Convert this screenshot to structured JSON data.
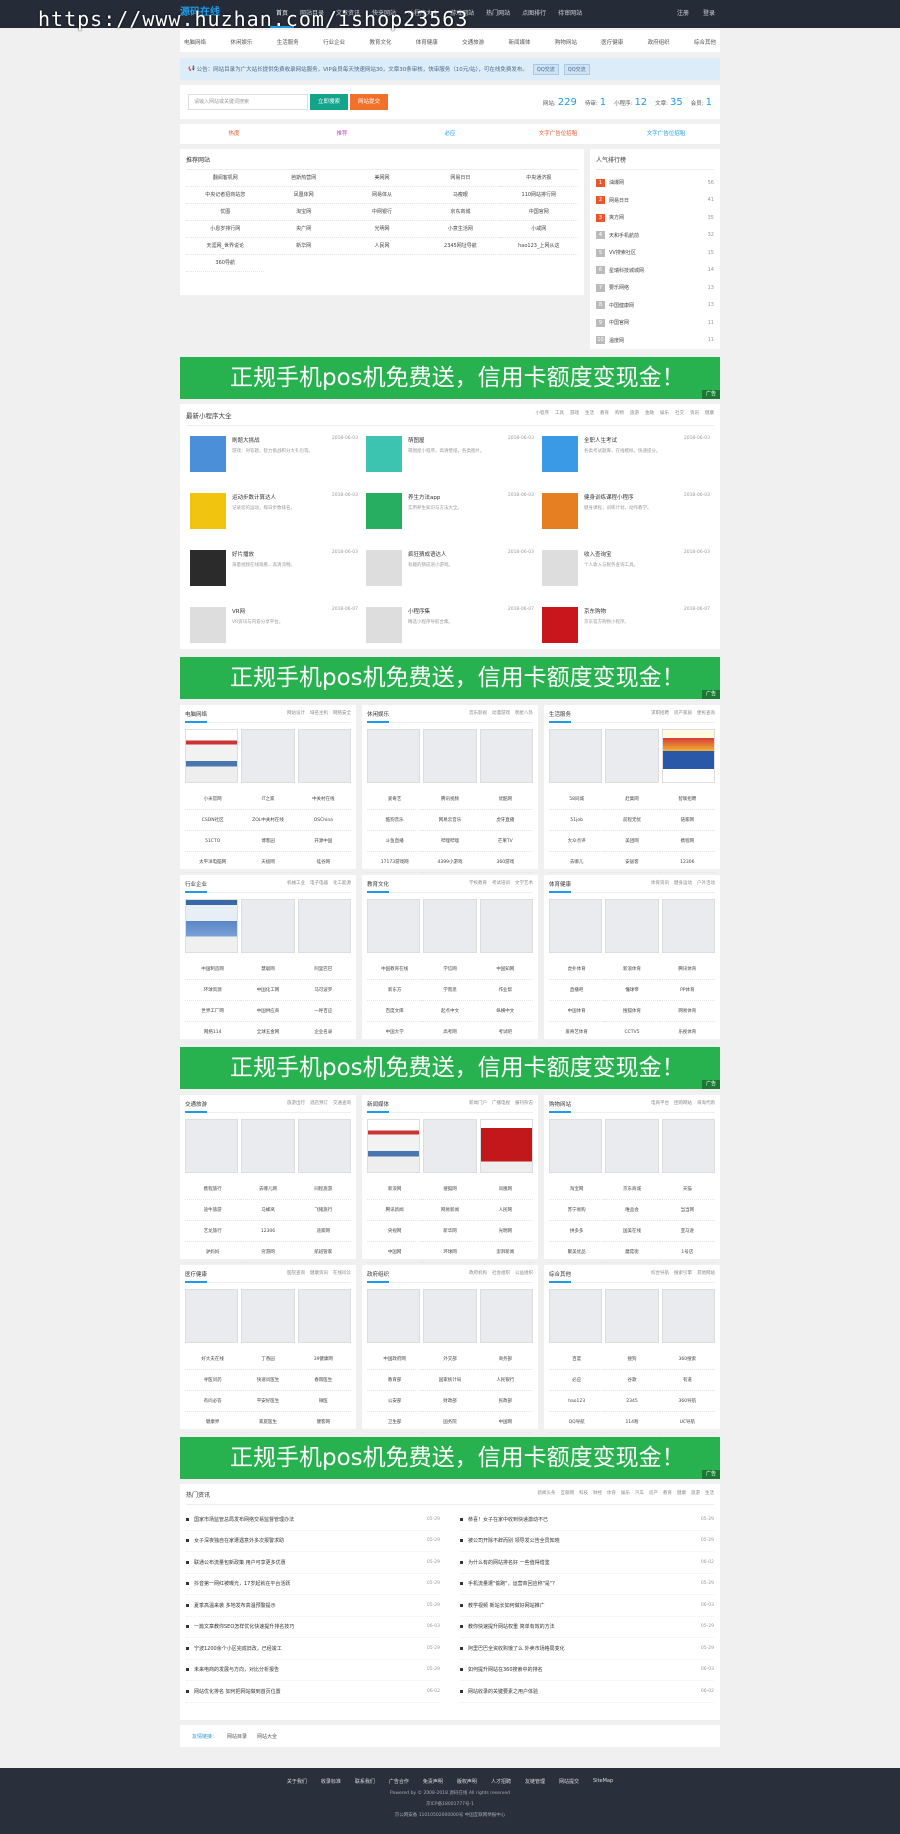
{
  "watermark": "https://www.huzhan.com/ishop23563",
  "logo": "源码在线",
  "topnav": [
    "首页",
    "网站目录",
    "文章资讯",
    "快来网站",
    "小程序大全",
    "游戏网站",
    "热门网站",
    "点图排行",
    "待审网站"
  ],
  "toplogin": [
    "注册",
    "登录"
  ],
  "catnav": [
    "电脑网络",
    "休闲娱乐",
    "生活服务",
    "行业企业",
    "教育文化",
    "体育健康",
    "交通旅游",
    "新闻媒体",
    "购物网站",
    "医疗健康",
    "政府组织",
    "综合其他"
  ],
  "notice": {
    "text": "公告：网站目录为广大站长提供免费收录网站服务，VIP会员每天快速网站30，文章30条审核，快审服务（10元/站），可在线免费发布。",
    "qq1": "QQ交流",
    "qq2": "QQ交流"
  },
  "search": {
    "placeholder": "请输入网站或关键词搜索",
    "btn1": "立即搜索",
    "btn2": "网站提交",
    "stats": [
      {
        "label": "网站:",
        "value": "229"
      },
      {
        "label": "待审:",
        "value": "1"
      },
      {
        "label": "小程序:",
        "value": "12"
      },
      {
        "label": "文章:",
        "value": "35"
      },
      {
        "label": "会员:",
        "value": "1"
      }
    ]
  },
  "tabs": [
    "热度",
    "推荐",
    "必应",
    "文字广告位招租",
    "文字广告位招租"
  ],
  "sites": {
    "title": "推荐网站",
    "items": [
      "翻阅客机网",
      "芭斯热营网",
      "美网网",
      "网易日日",
      "中央通济报",
      "中央记者招商站您",
      "凤凰体网",
      "网易体从",
      "马瘦眼",
      "110网站排行网",
      "优图",
      "淘宝网",
      "中网银行",
      "京东商城",
      "中国官网",
      "小恩岁排行网",
      "央广网",
      "光明网",
      "小意生活网",
      "小咸网",
      "天涯网_世界说论",
      "新华网",
      "人民网",
      "2345网址导航",
      "hao123_上网从这",
      "360导航"
    ]
  },
  "rank": {
    "title": "人气排行榜",
    "items": [
      {
        "n": "1",
        "name": "油爆网",
        "v": "56"
      },
      {
        "n": "2",
        "name": "网易日日",
        "v": "41"
      },
      {
        "n": "3",
        "name": "爽方网",
        "v": "35"
      },
      {
        "n": "4",
        "name": "天和手机航前",
        "v": "32"
      },
      {
        "n": "5",
        "name": "VV搜索社区",
        "v": "15"
      },
      {
        "n": "6",
        "name": "星瑞科技城城网",
        "v": "14"
      },
      {
        "n": "7",
        "name": "要乐网络",
        "v": "13"
      },
      {
        "n": "8",
        "name": "中国健康网",
        "v": "13"
      },
      {
        "n": "9",
        "name": "中国官网",
        "v": "11"
      },
      {
        "n": "10",
        "name": "温度网",
        "v": "11"
      }
    ]
  },
  "banner": {
    "text": "正规手机pos机免费送，信用卡额度变现金！",
    "ad": "广告"
  },
  "mini": {
    "title": "最新小程序大全",
    "cats": [
      "小程序",
      "工具",
      "游戏",
      "生活",
      "教育",
      "购物",
      "旅游",
      "金融",
      "娱乐",
      "社交",
      "资讯",
      "健康"
    ],
    "apps": [
      {
        "name": "刷题大挑战",
        "date": "2018-06-03",
        "desc": "游戏：对答题，智力挑战积分大礼包等。",
        "color": "#4a8fd8"
      },
      {
        "name": "萌图屋",
        "date": "2018-06-03",
        "desc": "萌图屋小程序，高清壁纸，各类图片。",
        "color": "#3cc4b0"
      },
      {
        "name": "全职人生考试",
        "date": "2018-06-03",
        "desc": "各类考试题库，在线模拟，快速提分。",
        "color": "#3a9ae6"
      },
      {
        "name": "运动步数计算达人",
        "date": "2018-06-03",
        "desc": "记录您的运动，每日步数排名。",
        "color": "#f1c40f"
      },
      {
        "name": "养生方法app",
        "date": "2018-06-03",
        "desc": "实用养生知识与方法大全。",
        "color": "#27ae60"
      },
      {
        "name": "健身训练课程小程序",
        "date": "2018-06-03",
        "desc": "健身课程，训练计划，动作教学。",
        "color": "#e67e22"
      },
      {
        "name": "好片播放",
        "date": "2018-06-03",
        "desc": "海量视频在线观看，高清流畅。",
        "color": "#2b2b2b"
      },
      {
        "name": "疯狂猜成语达人",
        "date": "2018-06-03",
        "desc": "有趣的猜成语小游戏。",
        "color": "#ddd"
      },
      {
        "name": "收入查询宝",
        "date": "2018-06-03",
        "desc": "个人收入与税务查询工具。",
        "color": "#ddd"
      },
      {
        "name": "VR网",
        "date": "2018-06-07",
        "desc": "VR资讯与内容分享平台。",
        "color": "#ddd"
      },
      {
        "name": "小程序集",
        "date": "2018-06-07",
        "desc": "精选小程序导航合集。",
        "color": "#ddd"
      },
      {
        "name": "京东购物",
        "date": "2018-06-07",
        "desc": "京东官方购物小程序。",
        "color": "#c8161d"
      }
    ]
  },
  "blocks1": [
    {
      "title": "电脑网络",
      "more": [
        "网站设计",
        "域名主机",
        "网络安全"
      ],
      "thumbs": [
        "c1",
        "",
        ""
      ],
      "links": [
        "小米官网",
        "IT之家",
        "中关村在线",
        "CSDN社区",
        "ZOL中关村在线",
        "OSChina",
        "51CTO",
        "博客园",
        "开源中国",
        "太平洋电脑网",
        "天极网",
        "硅谷网"
      ]
    },
    {
      "title": "休闲娱乐",
      "more": [
        "音乐影视",
        "动漫游戏",
        "明星八卦"
      ],
      "thumbs": [
        "",
        "",
        ""
      ],
      "links": [
        "爱奇艺",
        "腾讯视频",
        "优酷网",
        "酷狗音乐",
        "网易云音乐",
        "虎牙直播",
        "斗鱼直播",
        "哔哩哔哩",
        "芒果TV",
        "17173游戏网",
        "4399小游戏",
        "360游戏"
      ]
    },
    {
      "title": "生活服务",
      "more": [
        "求职招聘",
        "房产家居",
        "便民查询"
      ],
      "thumbs": [
        "",
        "",
        "c4"
      ],
      "links": [
        "58同城",
        "赶集网",
        "智联招聘",
        "51job",
        "前程无忧",
        "链家网",
        "大众点评",
        "美团网",
        "携程网",
        "去哪儿",
        "安居客",
        "12306"
      ]
    },
    {
      "title": "行业企业",
      "more": [
        "机械工业",
        "电子电器",
        "化工能源"
      ],
      "thumbs": [
        "c2",
        "",
        ""
      ],
      "links": [
        "中国制造网",
        "慧聪网",
        "阿里巴巴",
        "环球资源",
        "中国化工网",
        "马可波罗",
        "世界工厂网",
        "中国供应商",
        "一呼百应",
        "网络114",
        "全球五金网",
        "企业名录"
      ]
    },
    {
      "title": "教育文化",
      "more": [
        "学校教育",
        "考试培训",
        "文学艺术"
      ],
      "thumbs": [
        "",
        "",
        ""
      ],
      "links": [
        "中国教育在线",
        "学信网",
        "中国知网",
        "新东方",
        "学而思",
        "作业帮",
        "百度文库",
        "起点中文",
        "纵横中文",
        "中国大学",
        "高考网",
        "考试吧"
      ]
    },
    {
      "title": "体育健康",
      "more": [
        "体育资讯",
        "健身运动",
        "户外活动"
      ],
      "thumbs": [
        "",
        "",
        ""
      ],
      "links": [
        "虎扑体育",
        "新浪体育",
        "腾讯体育",
        "直播吧",
        "懂球帝",
        "PP体育",
        "中国体育",
        "搜狐体育",
        "网易体育",
        "爱奇艺体育",
        "CCTV5",
        "乐视体育"
      ]
    }
  ],
  "blocks2": [
    {
      "title": "交通旅游",
      "more": [
        "旅游出行",
        "酒店预订",
        "交通查询"
      ],
      "thumbs": [
        "",
        "",
        ""
      ],
      "links": [
        "携程旅行",
        "去哪儿网",
        "同程旅游",
        "途牛旅游",
        "马蜂窝",
        "飞猪旅行",
        "艺龙旅行",
        "12306",
        "途家网",
        "驴妈妈",
        "穷游网",
        "航班管家"
      ]
    },
    {
      "title": "新闻媒体",
      "more": [
        "新闻门户",
        "广播电视",
        "报刊杂志"
      ],
      "thumbs": [
        "c1",
        "",
        "c3"
      ],
      "links": [
        "新浪网",
        "搜狐网",
        "凤凰网",
        "腾讯新闻",
        "网易新闻",
        "人民网",
        "央视网",
        "新华网",
        "光明网",
        "中国网",
        "环球网",
        "澎湃新闻"
      ]
    },
    {
      "title": "购物网站",
      "more": [
        "电商平台",
        "团购网站",
        "海淘代购"
      ],
      "thumbs": [
        "",
        "",
        ""
      ],
      "links": [
        "淘宝网",
        "京东商城",
        "天猫",
        "苏宁易购",
        "唯品会",
        "当当网",
        "拼多多",
        "国美在线",
        "亚马逊",
        "聚美优品",
        "蘑菇街",
        "1号店"
      ]
    },
    {
      "title": "医疗健康",
      "more": [
        "医院查询",
        "健康资讯",
        "在线问诊"
      ],
      "thumbs": [
        "",
        "",
        ""
      ],
      "links": [
        "好大夫在线",
        "丁香园",
        "39健康网",
        "寻医问药",
        "快速问医生",
        "春雨医生",
        "有问必答",
        "平安好医生",
        "微医",
        "健康界",
        "家庭医生",
        "健客网"
      ]
    },
    {
      "title": "政府组织",
      "more": [
        "政府机构",
        "社会组织",
        "公益组织"
      ],
      "thumbs": [
        "",
        "",
        ""
      ],
      "links": [
        "中国政府网",
        "外交部",
        "商务部",
        "教育部",
        "国家统计局",
        "人民银行",
        "公安部",
        "财政部",
        "民政部",
        "卫生部",
        "国务院",
        "中国网"
      ]
    },
    {
      "title": "综合其他",
      "more": [
        "综合导航",
        "搜索引擎",
        "其他网站"
      ],
      "thumbs": [
        "",
        "",
        ""
      ],
      "links": [
        "百度",
        "搜狗",
        "360搜索",
        "必应",
        "谷歌",
        "有道",
        "hao123",
        "2345",
        "360导航",
        "QQ导航",
        "114啦",
        "UC导航"
      ]
    }
  ],
  "news": {
    "title": "热门资讯",
    "cats": [
      "新闻头条",
      "互联网",
      "科技",
      "财经",
      "体育",
      "娱乐",
      "汽车",
      "房产",
      "教育",
      "健康",
      "旅游",
      "生活"
    ],
    "left": [
      {
        "t": "国家市场监管总局发布网络交易监督管理办法",
        "d": "05-29"
      },
      {
        "t": "女子深夜独自在家遭遇意外多次报警求助",
        "d": "05-29"
      },
      {
        "t": "联通公布流量包新政策 用户可享更多优惠",
        "d": "05-29"
      },
      {
        "t": "抖音第一网红被曝光，17岁起就在平台活跃",
        "d": "05-29"
      },
      {
        "t": "夏季高温来袭 多地发布高温预警提示",
        "d": "05-29"
      },
      {
        "t": "一篇文章教你SEO怎样优化快速提升排名技巧",
        "d": "06-03"
      },
      {
        "t": "宁波1200余个小区完成旧改，已经竣工",
        "d": "05-29"
      },
      {
        "t": "未来电商的发展与方向，对比分析报告",
        "d": "05-29"
      },
      {
        "t": "网站优化排名 如何把网站做到首页位置",
        "d": "06-02"
      }
    ],
    "right": [
      {
        "t": "恭喜！女子在家中收到快递激动不已",
        "d": "05-29"
      },
      {
        "t": "被公司开除不辞而别 领导发公告全员知晓",
        "d": "05-29"
      },
      {
        "t": "为什么有的网站排名好 一些值得借鉴",
        "d": "06-02"
      },
      {
        "t": "手机流量遭\"偷跑\"，运营商回应称\"是\"？",
        "d": "05-29"
      },
      {
        "t": "教学视频 新站长如何做好网站推广",
        "d": "06-03"
      },
      {
        "t": "教你快速提升网站权重 简单有效的方法",
        "d": "05-29"
      },
      {
        "t": "阿里巴巴全资收购饿了么 外卖市场格局变化",
        "d": "05-29"
      },
      {
        "t": "如何提升网站在360搜索中的排名",
        "d": "06-03"
      },
      {
        "t": "网站收录的关键要素之用户体验",
        "d": "06-02"
      }
    ]
  },
  "flinks": {
    "title": "友情链接：",
    "items": [
      "网站目录",
      "网站大全"
    ]
  },
  "footer": {
    "links": [
      "关于我们",
      "收录标准",
      "联系我们",
      "广告合作",
      "免责声明",
      "版权声明",
      "人才招聘",
      "友链管理",
      "网站提交",
      "SiteMap"
    ],
    "copy": "Powered by © 2008-2018 源码在线 All rights reserved",
    "icp": "京ICP备18001777号-1",
    "police": "京公网安备 11010502000000号  中国互联网举报中心"
  }
}
